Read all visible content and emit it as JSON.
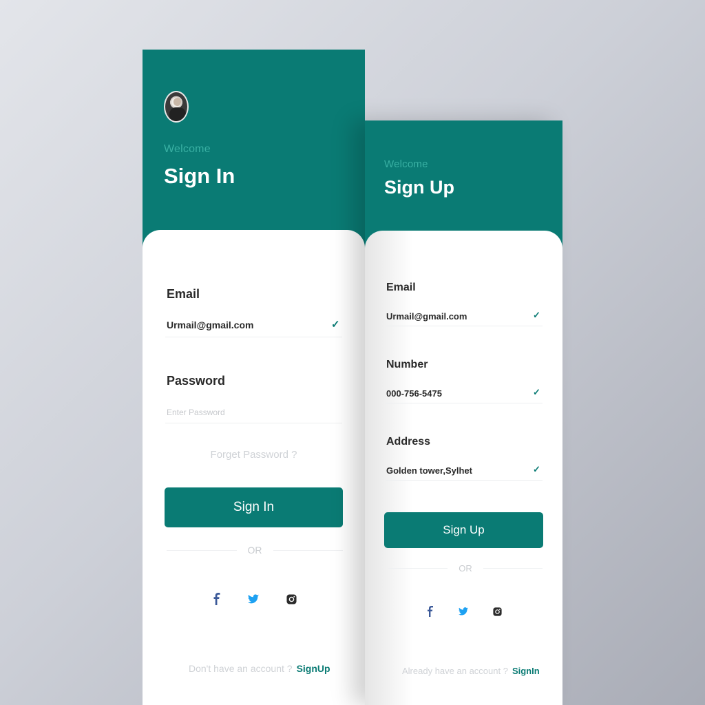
{
  "signin": {
    "welcome": "Welcome",
    "title": "Sign In",
    "email_label": "Email",
    "email_value": "Urmail@gmail.com",
    "password_label": "Password",
    "password_placeholder": "Enter Password",
    "forgot": "Forget Password ?",
    "button": "Sign In",
    "or": "OR",
    "footer_text": "Don't have an account ?",
    "footer_link": "SignUp"
  },
  "signup": {
    "welcome": "Welcome",
    "title": "Sign Up",
    "email_label": "Email",
    "email_value": "Urmail@gmail.com",
    "number_label": "Number",
    "number_value": "000-756-5475",
    "address_label": "Address",
    "address_value": "Golden tower,Sylhet",
    "button": "Sign Up",
    "or": "OR",
    "footer_text": "Already have an account ?",
    "footer_link": "SignIn"
  },
  "icons": {
    "avatar": "avatar",
    "check": "check-icon",
    "facebook": "facebook-icon",
    "twitter": "twitter-icon",
    "instagram": "instagram-icon"
  },
  "colors": {
    "accent": "#0a7b74",
    "welcome": "#39b0a3",
    "facebook": "#3b5998",
    "twitter": "#1da1f2",
    "instagram": "#2b2b2b"
  }
}
